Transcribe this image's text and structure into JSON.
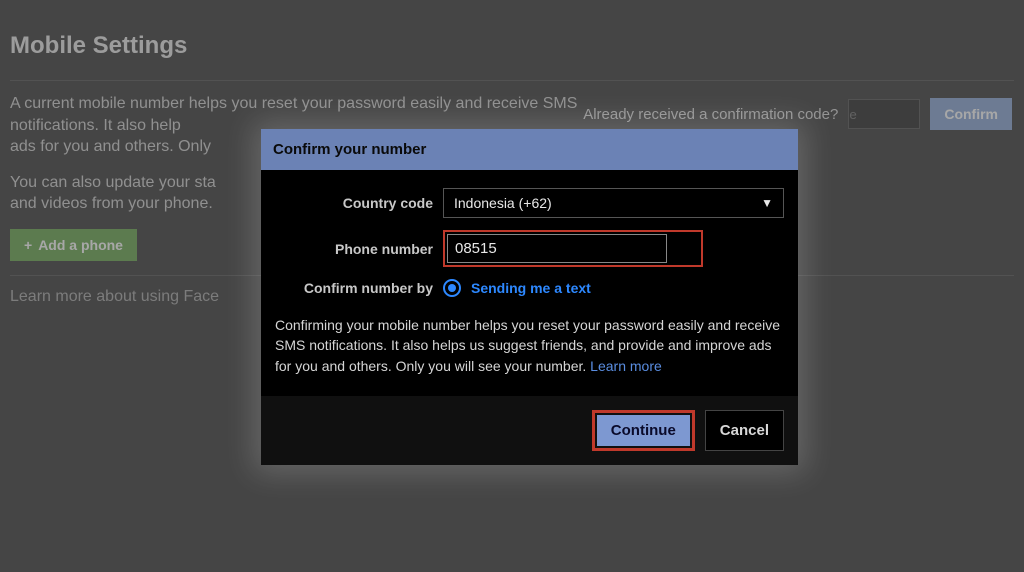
{
  "page": {
    "title": "Mobile Settings",
    "description1": "A current mobile number helps you reset your password easily and receive SMS notifications. It also help",
    "description1_cont": "ads for you and others. Only",
    "description2": "You can also update your sta",
    "description2_cont": "and videos from your phone.",
    "addPhoneLabel": "Add a phone",
    "learnMore": "Learn more about using Face",
    "confirmPanel": {
      "label": "Already received a confirmation code?",
      "buttonLabel": "Confirm",
      "codePlaceholder": "e"
    }
  },
  "modal": {
    "title": "Confirm your number",
    "countryLabel": "Country code",
    "countrySelected": "Indonesia (+62)",
    "phoneLabel": "Phone number",
    "phoneValue": "08515",
    "confirmByLabel": "Confirm number by",
    "radioOption": "Sending me a text",
    "description": "Confirming your mobile number helps you reset your password easily and receive SMS notifications. It also helps us suggest friends, and provide and improve ads for you and others. Only you will see your number.",
    "learnMoreLabel": "Learn more",
    "continueLabel": "Continue",
    "cancelLabel": "Cancel"
  }
}
